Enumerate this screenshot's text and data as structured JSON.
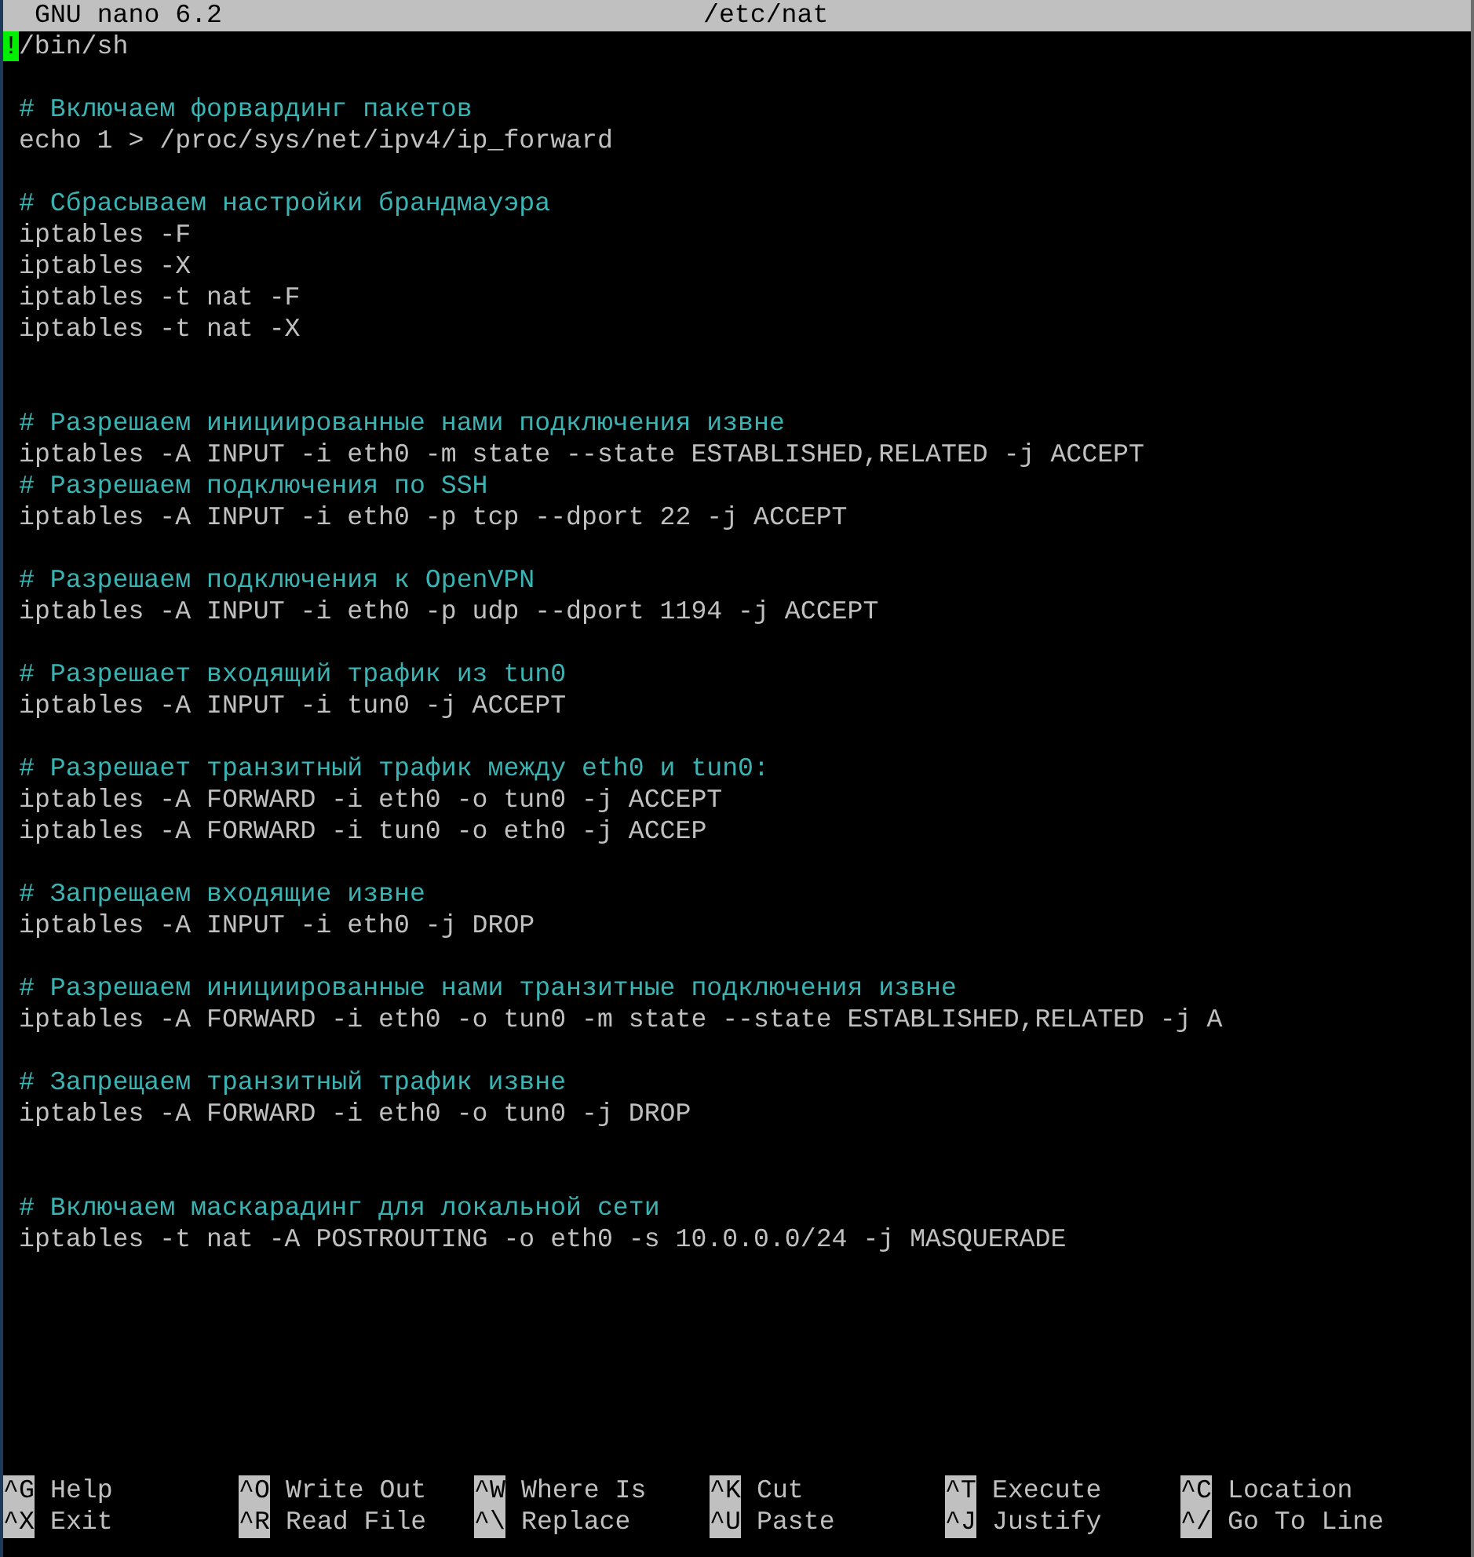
{
  "title_bar": {
    "app": "GNU nano 6.2",
    "file": "/etc/nat"
  },
  "lines": [
    {
      "kind": "cursor",
      "cursor": "!",
      "text": "/bin/sh"
    },
    {
      "kind": "blank"
    },
    {
      "kind": "comment",
      "text": "# Включаем форвардинг пакетов"
    },
    {
      "kind": "code",
      "text": "echo 1 > /proc/sys/net/ipv4/ip_forward"
    },
    {
      "kind": "blank"
    },
    {
      "kind": "comment",
      "text": "# Сбрасываем настройки брандмауэра"
    },
    {
      "kind": "code",
      "text": "iptables -F"
    },
    {
      "kind": "code",
      "text": "iptables -X"
    },
    {
      "kind": "code",
      "text": "iptables -t nat -F"
    },
    {
      "kind": "code",
      "text": "iptables -t nat -X"
    },
    {
      "kind": "blank"
    },
    {
      "kind": "blank"
    },
    {
      "kind": "comment",
      "text": "# Разрешаем инициированные нами подключения извне"
    },
    {
      "kind": "code",
      "text": "iptables -A INPUT -i eth0 -m state --state ESTABLISHED,RELATED -j ACCEPT"
    },
    {
      "kind": "comment",
      "text": "# Разрешаем подключения по SSH"
    },
    {
      "kind": "code",
      "text": "iptables -A INPUT -i eth0 -p tcp --dport 22 -j ACCEPT"
    },
    {
      "kind": "blank"
    },
    {
      "kind": "comment",
      "text": "# Разрешаем подключения к OpenVPN"
    },
    {
      "kind": "code",
      "text": "iptables -A INPUT -i eth0 -p udp --dport 1194 -j ACCEPT"
    },
    {
      "kind": "blank"
    },
    {
      "kind": "comment",
      "text": "# Разрешает входящий трафик из tun0"
    },
    {
      "kind": "code",
      "text": "iptables -A INPUT -i tun0 -j ACCEPT"
    },
    {
      "kind": "blank"
    },
    {
      "kind": "comment",
      "text": "# Разрешает транзитный трафик между eth0 и tun0:"
    },
    {
      "kind": "code",
      "text": "iptables -A FORWARD -i eth0 -o tun0 -j ACCEPT"
    },
    {
      "kind": "code",
      "text": "iptables -A FORWARD -i tun0 -o eth0 -j ACCEP"
    },
    {
      "kind": "blank"
    },
    {
      "kind": "comment",
      "text": "# Запрещаем входящие извне"
    },
    {
      "kind": "code",
      "text": "iptables -A INPUT -i eth0 -j DROP"
    },
    {
      "kind": "blank"
    },
    {
      "kind": "comment",
      "text": "# Разрешаем инициированные нами транзитные подключения извне"
    },
    {
      "kind": "code",
      "text": "iptables -A FORWARD -i eth0 -o tun0 -m state --state ESTABLISHED,RELATED -j A"
    },
    {
      "kind": "blank"
    },
    {
      "kind": "comment",
      "text": "# Запрещаем транзитный трафик извне"
    },
    {
      "kind": "code",
      "text": "iptables -A FORWARD -i eth0 -o tun0 -j DROP"
    },
    {
      "kind": "blank"
    },
    {
      "kind": "blank"
    },
    {
      "kind": "comment",
      "text": "# Включаем маскарадинг для локальной сети"
    },
    {
      "kind": "code",
      "text": "iptables -t nat -A POSTROUTING -o eth0 -s 10.0.0.0/24 -j MASQUERADE"
    }
  ],
  "shortcut_rows": [
    [
      {
        "key": "^G",
        "label": "Help"
      },
      {
        "key": "^O",
        "label": "Write Out"
      },
      {
        "key": "^W",
        "label": "Where Is"
      },
      {
        "key": "^K",
        "label": "Cut"
      },
      {
        "key": "^T",
        "label": "Execute"
      },
      {
        "key": "^C",
        "label": "Location"
      }
    ],
    [
      {
        "key": "^X",
        "label": "Exit"
      },
      {
        "key": "^R",
        "label": "Read File"
      },
      {
        "key": "^\\",
        "label": "Replace"
      },
      {
        "key": "^U",
        "label": "Paste"
      },
      {
        "key": "^J",
        "label": "Justify"
      },
      {
        "key": "^/",
        "label": "Go To Line"
      }
    ]
  ]
}
